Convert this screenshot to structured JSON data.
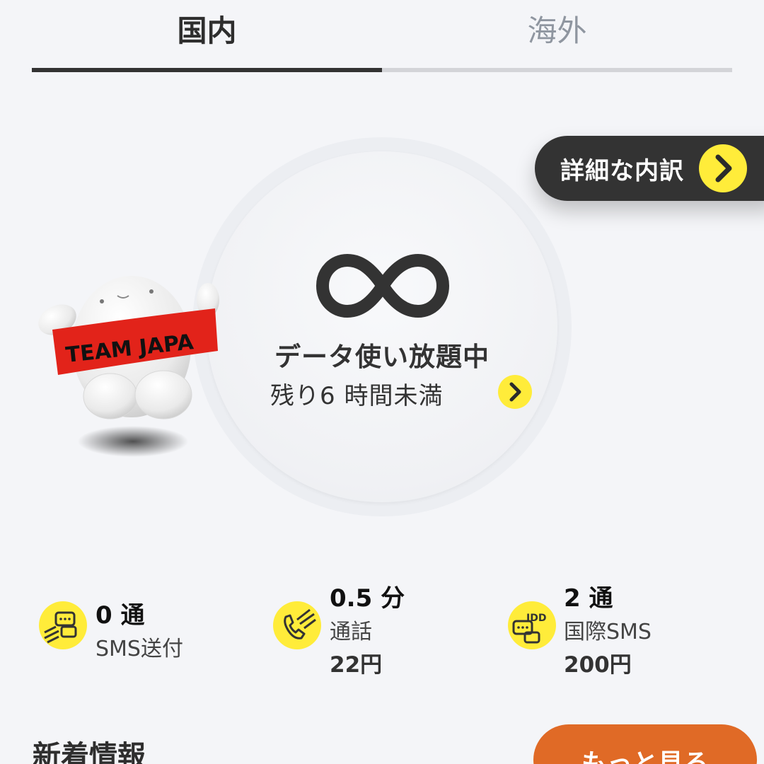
{
  "tabs": {
    "domestic": "国内",
    "overseas": "海外",
    "active": "domestic"
  },
  "detail": {
    "label": "詳細な内訳",
    "arrow_icon": "chevron-right-icon"
  },
  "data_usage": {
    "icon": "infinity-icon",
    "status": "データ使い放題中",
    "remaining": "残り6 時間未満"
  },
  "mascot": {
    "banner_text": "TEAM JAPA"
  },
  "stats": [
    {
      "value": "0 通",
      "label": "SMS送付",
      "price": "",
      "icon": "sms-icon"
    },
    {
      "value": "0.5 分",
      "label": "通話",
      "price": "22円",
      "icon": "phone-icon"
    },
    {
      "value": "2 通",
      "label": "国際SMS",
      "price": "200円",
      "icon": "idd-sms-icon"
    }
  ],
  "news": {
    "title": "新着情報",
    "more_label": "もっと見る"
  },
  "colors": {
    "accent_yellow": "#ffec3a",
    "dark": "#333333",
    "orange": "#e06a26",
    "background": "#f4f5f8",
    "banner_red": "#e2231a"
  }
}
